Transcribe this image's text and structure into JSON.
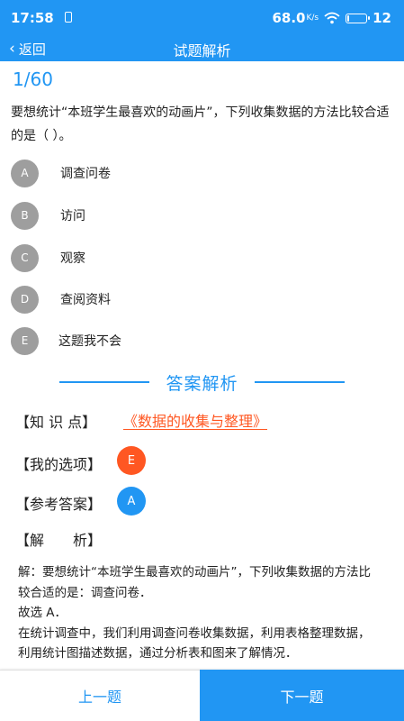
{
  "status_bar": {
    "time": "17:58",
    "speed": "68.0",
    "speed_unit": "K/s",
    "battery": "12",
    "battery_level_percent": 12,
    "icons": [
      "sim-icon",
      "wifi-icon",
      "battery-icon"
    ]
  },
  "nav": {
    "back_label": "返回",
    "title": "试题解析"
  },
  "question": {
    "number": "1/60",
    "text": "要想统计“本班学生最喜欢的动画片”，下列收集数据的方法比较合适的是（ ）。",
    "options": [
      {
        "letter": "A",
        "text": "调查问卷"
      },
      {
        "letter": "B",
        "text": "访问"
      },
      {
        "letter": "C",
        "text": "观察"
      },
      {
        "letter": "D",
        "text": "查阅资料"
      },
      {
        "letter": "E",
        "text": "这题我不会"
      }
    ]
  },
  "answer_section": {
    "title": "答案解析",
    "knowledge_label": "【知 识 点】",
    "knowledge_value": "《数据的收集与整理》",
    "my_choice_label": "【我的选项】",
    "my_choice_value": "E",
    "reference_label": "【参考答案】",
    "reference_value": "A",
    "analysis_label": "【解　　析】",
    "analysis_lines": [
      "解：要想统计“本班学生最喜欢的动画片”，下列收集数据的方法比较合适的是：调查问卷．",
      "故选 A．",
      "在统计调查中，我们利用调查问卷收集数据，利用表格整理数据，利用统计图描述数据，通过分析表和图来了解情况．"
    ]
  },
  "bottom": {
    "prev_label": "上一题",
    "next_label": "下一题"
  },
  "colors": {
    "primary": "#2196f3",
    "wrong": "#ff5722",
    "option_gray": "#9e9e9e"
  }
}
